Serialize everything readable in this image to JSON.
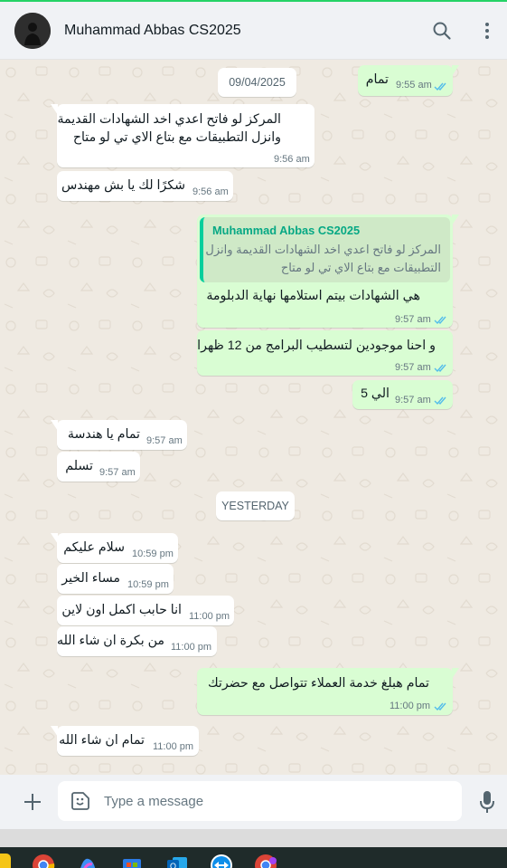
{
  "header": {
    "contact_name": "Muhammad Abbas CS2025",
    "icons": [
      "avatar",
      "search-icon",
      "menu-dots-icon"
    ]
  },
  "chat": {
    "messages": [
      {
        "dir": "out",
        "text": "تمام",
        "time": "9:55 am",
        "status": "read"
      },
      {
        "dir": "date",
        "text": "09/04/2025"
      },
      {
        "dir": "in",
        "lines": [
          "المركز لو فاتح اعدي اخد الشهادات القديمة",
          "وانزل التطبيقات مع بتاع الاي تي لو متاح"
        ],
        "time": "9:56 am"
      },
      {
        "dir": "in",
        "text": "شكرًا لك يا بش مهندس",
        "time": "9:56 am"
      },
      {
        "dir": "out",
        "quote": {
          "author": "Muhammad Abbas CS2025",
          "text": "المركز لو فاتح اعدي اخد الشهادات القديمة وانزل التطبيقات مع بتاع الاي تي لو متاح"
        },
        "text": "هي الشهادات بيتم استلامها نهاية الدبلومة",
        "time": "9:57 am",
        "status": "read"
      },
      {
        "dir": "out",
        "text": "و احنا موجودين لتسطيب البرامج من 12 ظهرا",
        "time": "9:57 am",
        "status": "read"
      },
      {
        "dir": "out",
        "text": "الي 5",
        "time": "9:57 am",
        "status": "read"
      },
      {
        "dir": "in",
        "text": "تمام يا هندسة",
        "time": "9:57 am"
      },
      {
        "dir": "in",
        "text": "تسلم",
        "time": "9:57 am"
      },
      {
        "dir": "date",
        "text": "YESTERDAY"
      },
      {
        "dir": "in",
        "text": "سلام عليكم",
        "time": "10:59 pm"
      },
      {
        "dir": "in",
        "text": "مساء الخير",
        "time": "10:59 pm"
      },
      {
        "dir": "in",
        "text": "انا حابب اكمل اون لاين",
        "time": "11:00 pm"
      },
      {
        "dir": "in",
        "text": "من بكرة ان شاء الله",
        "time": "11:00 pm"
      },
      {
        "dir": "out",
        "text": "تمام هبلغ خدمة العملاء تتواصل مع حضرتك",
        "time": "11:00 pm",
        "status": "read"
      },
      {
        "dir": "in",
        "text": "تمام ان شاء الله",
        "time": "11:00 pm"
      }
    ]
  },
  "composer": {
    "placeholder": "Type a message",
    "icons": [
      "plus-icon",
      "sticker-icon",
      "mic-icon"
    ]
  },
  "colors": {
    "accent": "#25d366",
    "outgoing_bubble": "#d9fdd3",
    "incoming_bubble": "#ffffff",
    "chat_background": "#efeae2",
    "read_tick": "#53bdeb"
  },
  "taskbar": {
    "icons": [
      "windows-start-icon",
      "chrome-icon",
      "copilot-icon",
      "store-icon",
      "outlook-icon",
      "teamviewer-icon",
      "chrome-profile-icon"
    ]
  }
}
